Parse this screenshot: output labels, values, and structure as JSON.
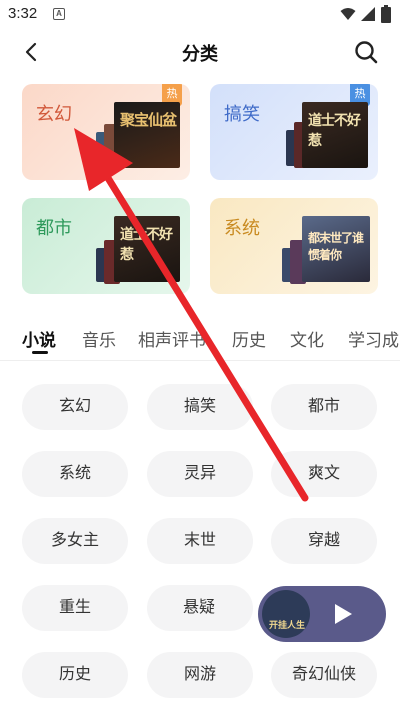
{
  "status_bar": {
    "time": "3:32",
    "notification_icon": "A"
  },
  "header": {
    "title": "分类",
    "back_icon": "chevron-left-icon",
    "search_icon": "search-icon"
  },
  "category_cards": [
    {
      "label": "玄幻",
      "hot": true,
      "hot_label": "热",
      "cover_text": "聚宝仙盆",
      "colors": {
        "bg": "#fde3d6",
        "label": "#d1583a"
      }
    },
    {
      "label": "搞笑",
      "hot": true,
      "hot_label": "热",
      "cover_text": "道士不好惹",
      "colors": {
        "bg": "#dfe8fb",
        "label": "#3f6bc8"
      }
    },
    {
      "label": "都市",
      "hot": false,
      "cover_text": "道士不好惹",
      "colors": {
        "bg": "#d8f1e2",
        "label": "#2f9a5c"
      }
    },
    {
      "label": "系统",
      "hot": false,
      "cover_text": "都末世了谁惯着你",
      "colors": {
        "bg": "#fbefd3",
        "label": "#c98b22"
      }
    }
  ],
  "tabs": [
    {
      "label": "小说",
      "active": true
    },
    {
      "label": "音乐",
      "active": false
    },
    {
      "label": "相声评书",
      "active": false
    },
    {
      "label": "历史",
      "active": false
    },
    {
      "label": "文化",
      "active": false
    },
    {
      "label": "学习成",
      "active": false
    }
  ],
  "chips": [
    "玄幻",
    "搞笑",
    "都市",
    "系统",
    "灵异",
    "爽文",
    "多女主",
    "末世",
    "穿越",
    "重生",
    "悬疑",
    "",
    "历史",
    "网游",
    "奇幻仙侠"
  ],
  "mini_player": {
    "cover_text": "开挂人生",
    "play_icon": "play-icon"
  },
  "annotation": {
    "color": "#e8262a"
  }
}
